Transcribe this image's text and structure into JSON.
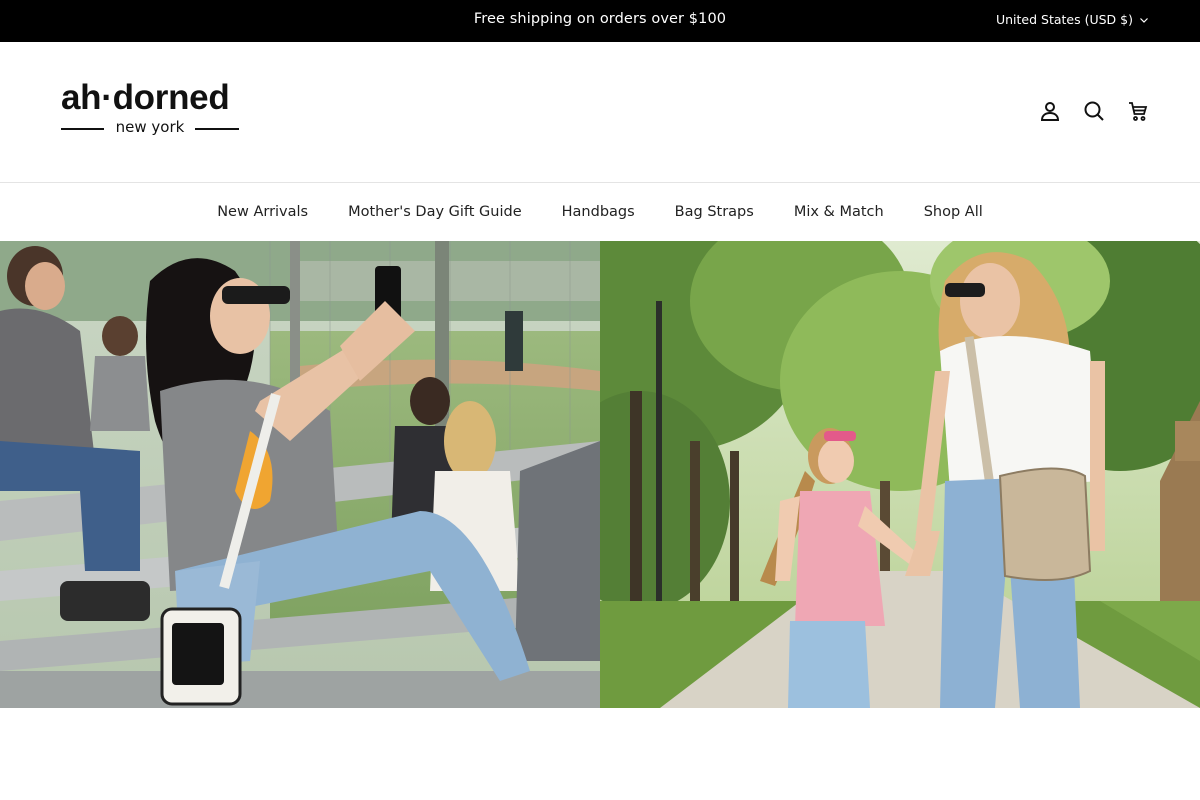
{
  "announcement": {
    "text": "Free shipping on orders over $100",
    "currency": "United States (USD $)"
  },
  "header": {
    "logo_main": "ah·dorned",
    "logo_sub": "new york",
    "icons": [
      "account-icon",
      "search-icon",
      "cart-icon"
    ]
  },
  "nav": {
    "items": [
      {
        "label": "New Arrivals"
      },
      {
        "label": "Mother's Day Gift Guide"
      },
      {
        "label": "Handbags"
      },
      {
        "label": "Bag Straps"
      },
      {
        "label": "Mix & Match"
      },
      {
        "label": "Shop All"
      }
    ]
  },
  "hero": {
    "left_image": "woman-photographing-at-baseball-game",
    "right_image": "mother-and-daughter-walking-in-park"
  },
  "colors": {
    "announcement_bg": "#000000",
    "announcement_text": "#ffffff",
    "text": "#111111",
    "divider": "#e4e4e4"
  }
}
